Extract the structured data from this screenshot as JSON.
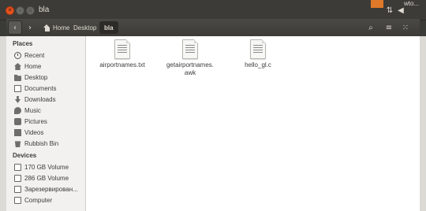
{
  "window": {
    "title": "bla",
    "panel_text": "wto..."
  },
  "toolbar": {
    "back_icon": "chevron-left-icon",
    "forward_icon": "chevron-right-icon",
    "breadcrumbs": [
      "Home",
      "Desktop",
      "bla"
    ],
    "search_icon": "search-icon",
    "list_view_icon": "list-icon",
    "grid_view_icon": "grid-icon"
  },
  "sidebar": {
    "places_header": "Places",
    "places": [
      {
        "label": "Recent",
        "icon": "clock-icon"
      },
      {
        "label": "Home",
        "icon": "home-icon"
      },
      {
        "label": "Desktop",
        "icon": "folder-icon"
      },
      {
        "label": "Documents",
        "icon": "document-icon"
      },
      {
        "label": "Downloads",
        "icon": "download-icon"
      },
      {
        "label": "Music",
        "icon": "music-icon"
      },
      {
        "label": "Pictures",
        "icon": "picture-icon"
      },
      {
        "label": "Videos",
        "icon": "video-icon"
      },
      {
        "label": "Rubbish Bin",
        "icon": "trash-icon"
      }
    ],
    "devices_header": "Devices",
    "devices": [
      {
        "label": "170 GB Volume",
        "icon": "drive-icon"
      },
      {
        "label": "286 GB Volume",
        "icon": "drive-icon"
      },
      {
        "label": "Зарезервирован...",
        "icon": "drive-icon"
      },
      {
        "label": "Computer",
        "icon": "computer-icon"
      }
    ]
  },
  "files": [
    {
      "name": "airportnames.txt",
      "icon": "text-file-icon"
    },
    {
      "name": "getairportnames.\nawk",
      "icon": "text-file-icon"
    },
    {
      "name": "hello_gl.c",
      "icon": "c-source-file-icon"
    }
  ],
  "colors": {
    "panel_bg": "#3c3b37",
    "close_button": "#e95420",
    "sidebar_bg": "#f2f1f0",
    "content_bg": "#ffffff"
  }
}
